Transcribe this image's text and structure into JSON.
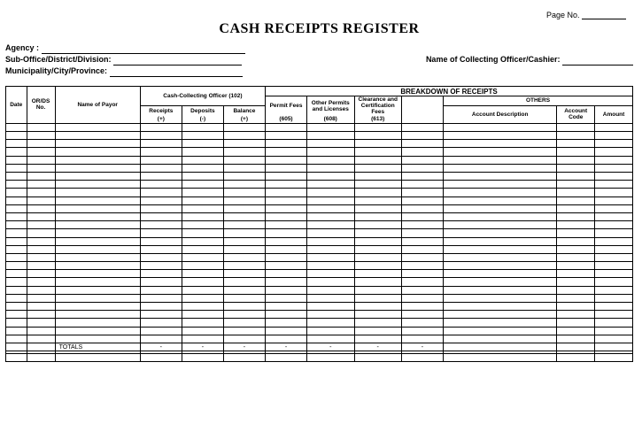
{
  "page_no_label": "Page No.",
  "title": "CASH RECEIPTS REGISTER",
  "header_labels": {
    "agency": "Agency :",
    "sub_office": "Sub-Office/District/Division:",
    "municipality": "Municipality/City/Province:",
    "collecting_officer": "Name of Collecting Officer/Cashier:"
  },
  "columns": {
    "date": "Date",
    "or_ds": "OR/DS No.",
    "payor": "Name of Payor",
    "cash_collecting_group": "Cash-Collecting Officer     (102)",
    "receipts": "Receipts",
    "receipts_sign": "(+)",
    "deposits": "Deposits",
    "deposits_sign": "(-)",
    "balance": "Balance",
    "balance_sign": "(+)",
    "breakdown_group": "BREAKDOWN OF RECEIPTS",
    "permit_fees": "Permit Fees",
    "permit_fees_code": "(605)",
    "other_permits": "Other Permits and Licenses",
    "other_permits_code": "(608)",
    "clearance": "Clearance and Certification Fees",
    "clearance_code": "(613)",
    "blank_col": "",
    "others_group": "OTHERS",
    "account_desc": "Account Description",
    "account_code": "Account Code",
    "amount": "Amount"
  },
  "totals_label": "TOTALS",
  "dash": "-",
  "body_row_count": 27
}
